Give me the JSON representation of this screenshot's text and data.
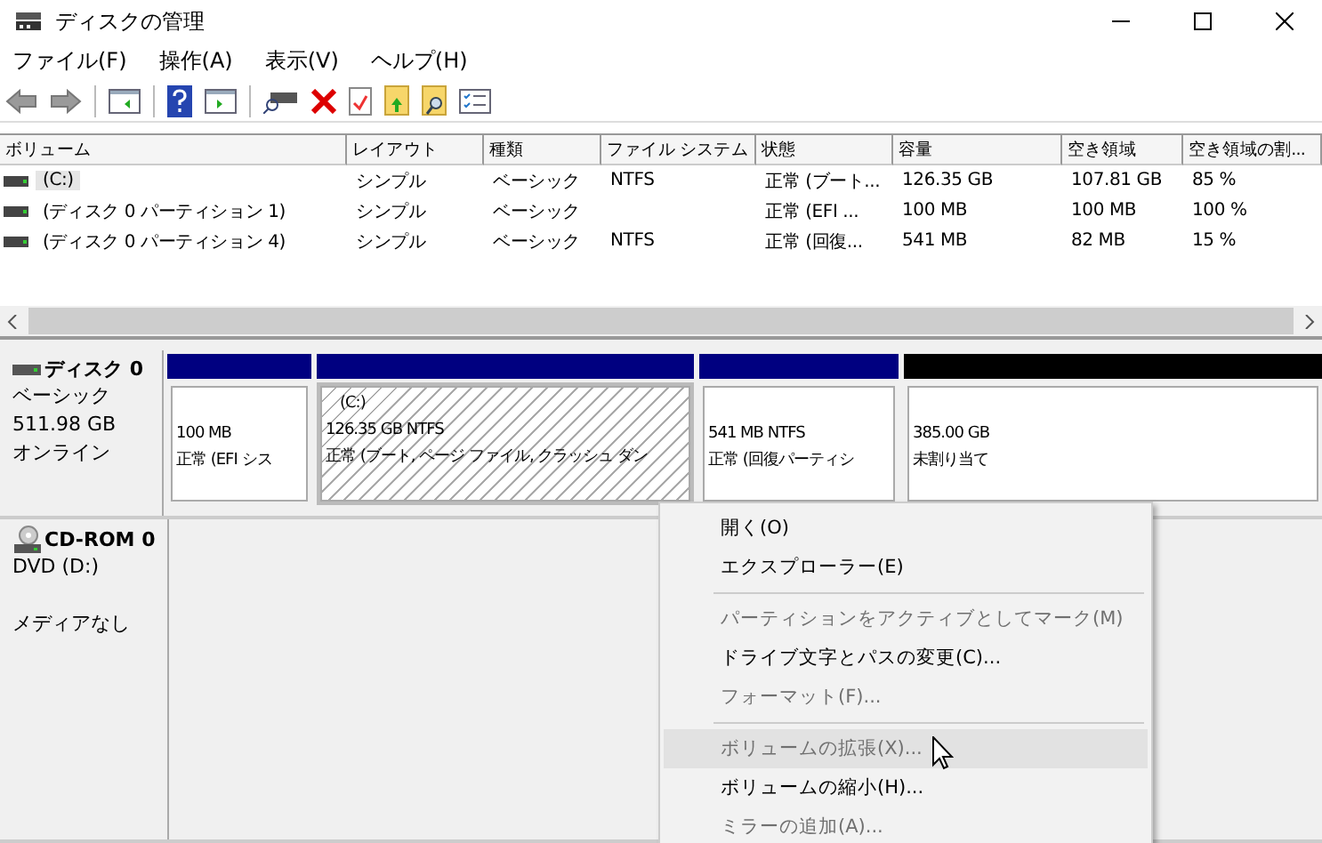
{
  "window": {
    "title": "ディスクの管理"
  },
  "menu": [
    "ファイル(F)",
    "操作(A)",
    "表示(V)",
    "ヘルプ(H)"
  ],
  "table": {
    "columns": [
      "ボリューム",
      "レイアウト",
      "種類",
      "ファイル システム",
      "状態",
      "容量",
      "空き領域",
      "空き領域の割..."
    ],
    "rows": [
      {
        "selected": true,
        "cells": [
          "(C:)",
          "シンプル",
          "ベーシック",
          "NTFS",
          "正常 (ブート...",
          "126.35 GB",
          "107.81 GB",
          "85 %"
        ]
      },
      {
        "selected": false,
        "cells": [
          "(ディスク 0 パーティション 1)",
          "シンプル",
          "ベーシック",
          "",
          "正常 (EFI ...",
          "100 MB",
          "100 MB",
          "100 %"
        ]
      },
      {
        "selected": false,
        "cells": [
          "(ディスク 0 パーティション 4)",
          "シンプル",
          "ベーシック",
          "NTFS",
          "正常 (回復...",
          "541 MB",
          "82 MB",
          "15 %"
        ]
      }
    ]
  },
  "disks": [
    {
      "kind": "disk",
      "name": "ディスク 0",
      "lines": [
        "ベーシック",
        "511.98 GB",
        "オンライン"
      ],
      "partitions": [
        {
          "kind": "primary",
          "selected": false,
          "lines": [
            "100 MB",
            "正常 (EFI シス"
          ]
        },
        {
          "kind": "primary",
          "selected": true,
          "lines": [
            "(C:)",
            "126.35 GB NTFS",
            "正常 (ブート, ページ ファイル, クラッシュ ダン"
          ]
        },
        {
          "kind": "primary",
          "selected": false,
          "lines": [
            "541 MB NTFS",
            "正常 (回復パーティシ"
          ]
        },
        {
          "kind": "unallocated",
          "selected": false,
          "lines": [
            "385.00 GB",
            "未割り当て"
          ]
        }
      ]
    },
    {
      "kind": "cdrom",
      "name": "CD-ROM 0",
      "lines": [
        "DVD (D:)",
        "メディアなし"
      ]
    }
  ],
  "context_menu": [
    {
      "kind": "item",
      "label": "開く(O)",
      "disabled": false,
      "selected": false
    },
    {
      "kind": "item",
      "label": "エクスプローラー(E)",
      "disabled": false,
      "selected": false
    },
    {
      "kind": "separator"
    },
    {
      "kind": "item",
      "label": "パーティションをアクティブとしてマーク(M)",
      "disabled": true,
      "selected": false
    },
    {
      "kind": "item",
      "label": "ドライブ文字とパスの変更(C)...",
      "disabled": false,
      "selected": false
    },
    {
      "kind": "item",
      "label": "フォーマット(F)...",
      "disabled": true,
      "selected": false
    },
    {
      "kind": "separator"
    },
    {
      "kind": "item",
      "label": "ボリュームの拡張(X)...",
      "disabled": true,
      "selected": true
    },
    {
      "kind": "item",
      "label": "ボリュームの縮小(H)...",
      "disabled": false,
      "selected": false
    },
    {
      "kind": "item",
      "label": "ミラーの追加(A)...",
      "disabled": true,
      "selected": false
    }
  ]
}
